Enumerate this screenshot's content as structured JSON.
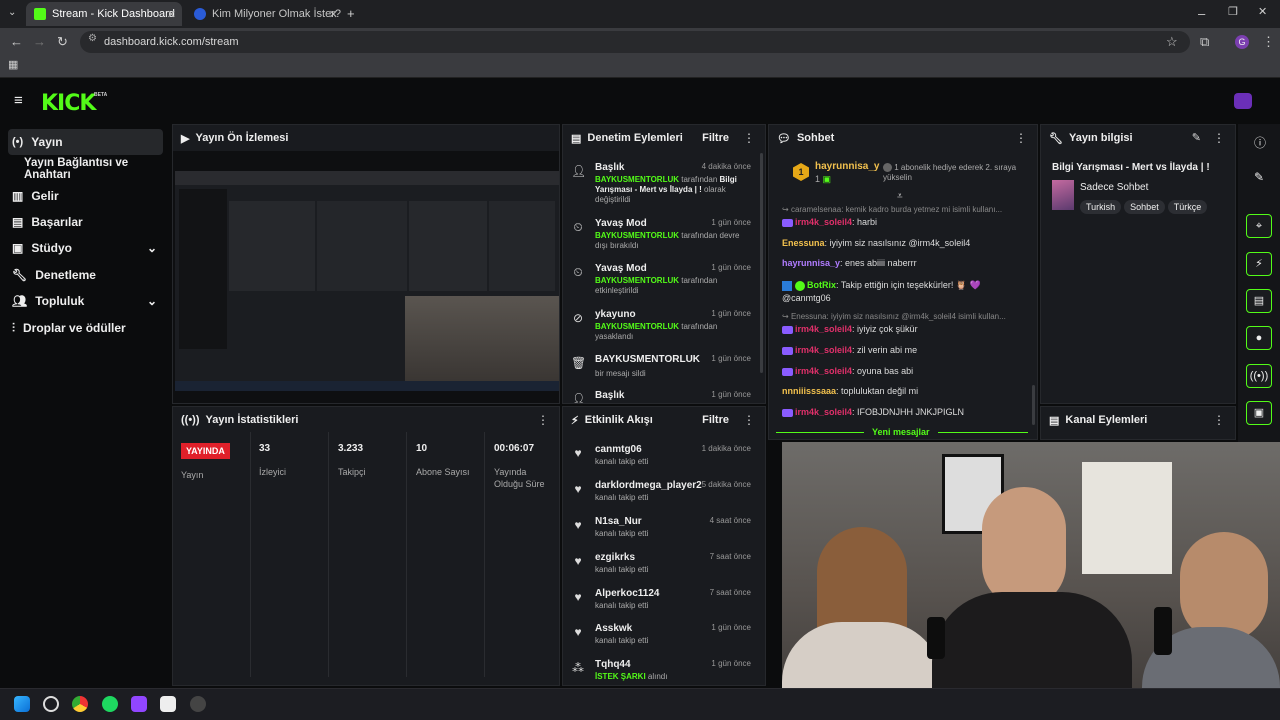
{
  "browser": {
    "tabs": [
      {
        "title": "Stream - Kick Dashboard",
        "active": true
      },
      {
        "title": "Kim Milyoner Olmak İster? - Qu",
        "active": false
      }
    ],
    "url": "dashboard.kick.com/stream"
  },
  "brand": {
    "logo": "KICK",
    "beta": "BETA",
    "accent": "#53fc18"
  },
  "sidebar": {
    "items": [
      {
        "label": "Yayın",
        "icon": "broadcast-icon",
        "active": true
      },
      {
        "label": "Yayın Bağlantısı ve Anahtarı"
      },
      {
        "label": "Gelir",
        "icon": "revenue-icon"
      },
      {
        "label": "Başarılar",
        "icon": "trophy-icon"
      },
      {
        "label": "Stüdyo",
        "icon": "studio-icon"
      },
      {
        "label": "Denetleme",
        "icon": "wrench-icon"
      },
      {
        "label": "Topluluk",
        "icon": "community-icon"
      },
      {
        "label": "Droplar ve ödüller",
        "icon": "gift-icon"
      }
    ]
  },
  "preview": {
    "title": "Yayın Ön İzlemesi"
  },
  "stats": {
    "title": "Yayın İstatistikleri",
    "live_badge": "YAYINDA",
    "live_label": "Yayın",
    "items": [
      {
        "value": "33",
        "label": "İzleyici"
      },
      {
        "value": "3.233",
        "label": "Takipçi"
      },
      {
        "value": "10",
        "label": "Abone Sayısı"
      },
      {
        "value": "00:06:07",
        "label": "Yayında Olduğu Süre"
      }
    ]
  },
  "mod_actions": {
    "title": "Denetim Eylemleri",
    "filter": "Filtre",
    "items": [
      {
        "name": "Başlık",
        "time": "4 dakika önce",
        "actor": "BAYKUSMENTORLUK",
        "text": " tarafından ",
        "bold": "Bilgi Yarışması - Mert vs İlayda | !",
        "tail": " olarak değiştirildi"
      },
      {
        "name": "Yavaş Mod",
        "time": "1 gün önce",
        "actor": "BAYKUSMENTORLUK",
        "text": " tarafından devre dışı bırakıldı"
      },
      {
        "name": "Yavaş Mod",
        "time": "1 gün önce",
        "actor": "BAYKUSMENTORLUK",
        "text": " tarafından etkinleştirildi"
      },
      {
        "name": "ykayuno",
        "time": "1 gün önce",
        "actor": "BAYKUSMENTORLUK",
        "text": " tarafından yasaklandı"
      },
      {
        "name": "BAYKUSMENTORLUK",
        "time": "1 gün önce",
        "text": "bir mesajı sildi"
      },
      {
        "name": "Başlık",
        "time": "1 gün önce"
      }
    ]
  },
  "activity": {
    "title": "Etkinlik Akışı",
    "filter": "Filtre",
    "items": [
      {
        "name": "canmtg06",
        "time": "1 dakika önce",
        "text": "kanalı takip etti"
      },
      {
        "name": "darklordmega_player2",
        "time": "5 dakika önce",
        "text": "kanalı takip etti"
      },
      {
        "name": "N1sa_Nur",
        "time": "4 saat önce",
        "text": "kanalı takip etti"
      },
      {
        "name": "ezgikrks",
        "time": "7 saat önce",
        "text": "kanalı takip etti"
      },
      {
        "name": "Alperkoc1124",
        "time": "7 saat önce",
        "text": "kanalı takip etti"
      },
      {
        "name": "Asskwk",
        "time": "1 gün önce",
        "text": "kanalı takip etti"
      },
      {
        "name": "Tqhq44",
        "time": "1 gün önce",
        "highlight": "İSTEK ŞARKI",
        "text": " alındı"
      }
    ]
  },
  "chat": {
    "title": "Sohbet",
    "gifter": {
      "name": "hayrunnisa_y",
      "count": "1",
      "rank": "1",
      "note": "1 abonelik hediye ederek 2. sıraya yükselin"
    },
    "new_messages": "Yeni mesajlar",
    "messages": [
      {
        "reply": "caramelsenaa: kemik kadro burda yetmez mi isimli kullanı..."
      },
      {
        "user": "irm4k_soleil4",
        "color": "#e0306a",
        "text": ": harbi",
        "badge": true
      },
      {
        "user": "Enessuna",
        "color": "#f2c14e",
        "text": ": iyiyim siz nasılsınız @irm4k_soleil4"
      },
      {
        "user": "hayrunnisa_y",
        "color": "#b07cff",
        "text": ": enes abiiii naberrr"
      },
      {
        "user": "BotRix",
        "color": "#53fc18",
        "text": ": Takip ettiğin için teşekkürler! 🦉 💜 @canmtg06",
        "bot": true
      },
      {
        "reply": "Enessuna: iyiyim siz nasılsınız @irm4k_soleil4 isimli kullan..."
      },
      {
        "user": "irm4k_soleil4",
        "color": "#e0306a",
        "text": ": iyiyiz çok şükür",
        "badge": true
      },
      {
        "user": "irm4k_soleil4",
        "color": "#e0306a",
        "text": ": zil verin abi me",
        "badge": true
      },
      {
        "user": "irm4k_soleil4",
        "color": "#e0306a",
        "text": ": oyuna bas abi",
        "badge": true
      },
      {
        "user": "nnniiisssaaa",
        "color": "#f2c14e",
        "text": ": topluluktan değil mi"
      },
      {
        "user": "irm4k_soleil4",
        "color": "#e0306a",
        "text": ": IFOBJDNJHH JNKJPIGLN",
        "badge": true
      }
    ]
  },
  "stream_info": {
    "title": "Yayın bilgisi",
    "stream_title": "Bilgi Yarışması - Mert vs İlayda | !",
    "category": "Sadece Sohbet",
    "tags": [
      "Turkish",
      "Sohbet",
      "Türkçe"
    ]
  },
  "channel_actions": {
    "title": "Kanal Eylemleri"
  }
}
